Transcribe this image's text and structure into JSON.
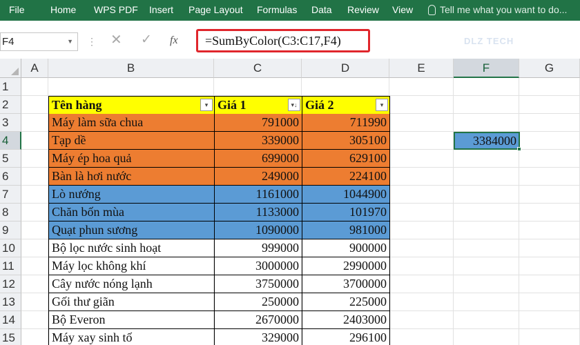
{
  "ribbon": {
    "tabs": [
      "File",
      "Home",
      "WPS PDF",
      "Insert",
      "Page Layout",
      "Formulas",
      "Data",
      "Review",
      "View"
    ],
    "tell_me": "Tell me what you want to do..."
  },
  "formula_bar": {
    "name_box": "F4",
    "formula": "=SumByColor(C3:C17,F4)",
    "fx_label": "fx",
    "cancel_glyph": "✕",
    "enter_glyph": "✓"
  },
  "watermark": "DLZ TECH",
  "columns": [
    "A",
    "B",
    "C",
    "D",
    "E",
    "F",
    "G"
  ],
  "selected_column": "F",
  "rows": [
    "1",
    "2",
    "3",
    "4",
    "5",
    "6",
    "7",
    "8",
    "9",
    "10",
    "11",
    "12",
    "13",
    "14",
    "15"
  ],
  "selected_row": "4",
  "table": {
    "headers": [
      "Tên hàng",
      "Giá 1",
      "Giá 2"
    ],
    "rows": [
      {
        "name": "Máy làm sữa chua",
        "p1": "791000",
        "p2": "711990",
        "fill": "orange"
      },
      {
        "name": "Tạp dề",
        "p1": "339000",
        "p2": "305100",
        "fill": "orange"
      },
      {
        "name": "Máy ép hoa quả",
        "p1": "699000",
        "p2": "629100",
        "fill": "orange"
      },
      {
        "name": "Bàn là hơi nước",
        "p1": "249000",
        "p2": "224100",
        "fill": "orange"
      },
      {
        "name": "Lò nướng",
        "p1": "1161000",
        "p2": "1044900",
        "fill": "blue"
      },
      {
        "name": "Chăn bốn mùa",
        "p1": "1133000",
        "p2": "101970",
        "fill": "blue"
      },
      {
        "name": "Quạt phun sương",
        "p1": "1090000",
        "p2": "981000",
        "fill": "blue"
      },
      {
        "name": "Bộ lọc nước sinh hoạt",
        "p1": "999000",
        "p2": "900000",
        "fill": "none"
      },
      {
        "name": "Máy lọc không khí",
        "p1": "3000000",
        "p2": "2990000",
        "fill": "none"
      },
      {
        "name": "Cây nước nóng lạnh",
        "p1": "3750000",
        "p2": "3700000",
        "fill": "none"
      },
      {
        "name": "Gối thư giãn",
        "p1": "250000",
        "p2": "225000",
        "fill": "none"
      },
      {
        "name": "Bộ Everon",
        "p1": "2670000",
        "p2": "2403000",
        "fill": "none"
      },
      {
        "name": "Máy xay sinh tố",
        "p1": "329000",
        "p2": "296100",
        "fill": "none"
      }
    ]
  },
  "result_cell": {
    "ref": "F4",
    "value": "3384000"
  },
  "colors": {
    "ribbon": "#217346",
    "orange": "#ed7d31",
    "blue": "#5b9bd5",
    "header_yellow": "#ffff00",
    "highlight": "#e0262c"
  }
}
